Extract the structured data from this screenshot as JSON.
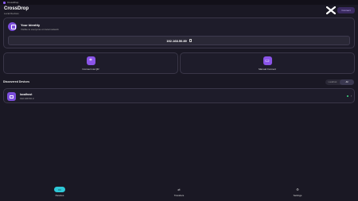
{
  "window": {
    "title": "CrossDrop"
  },
  "header": {
    "title": "CrossDrop",
    "subtitle": "Local Devices",
    "top_button_label": "Connect"
  },
  "identity": {
    "title": "Your Identity",
    "subtitle": "Visible to everyone on local network",
    "ip": "192.168.50.89",
    "icon": "home-icon"
  },
  "actions": {
    "qr": {
      "label": "Connect via QR",
      "icon": "qr-icon"
    },
    "manual": {
      "label": "Manual Connect",
      "icon": "keyboard-icon"
    }
  },
  "discovered": {
    "title": "Discovered Devices",
    "filter": {
      "options": [
        "Localhost",
        "All"
      ],
      "selected": "All"
    },
    "devices": [
      {
        "name": "localhost",
        "ip": "192.168.50.3",
        "status": "online",
        "status_color": "#3ddc84"
      }
    ]
  },
  "nav": {
    "items": [
      {
        "label": "Devices",
        "icon": "devices-icon",
        "active": true
      },
      {
        "label": "Transfers",
        "icon": "transfers-icon",
        "active": false
      },
      {
        "label": "Settings",
        "icon": "gear-icon",
        "active": false
      }
    ]
  },
  "colors": {
    "accent": "#8a54e8",
    "active_nav": "#2ec8d8",
    "background": "#1a1824"
  }
}
